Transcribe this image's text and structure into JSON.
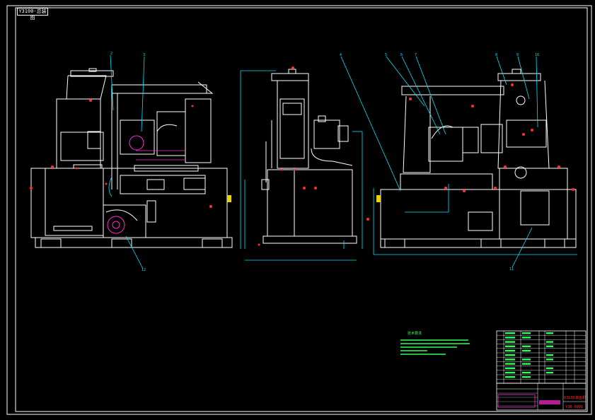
{
  "sheet": {
    "code_label": "Y3100-总装图",
    "background": "#000000",
    "line_color": "#ffffff",
    "dim_color": "#00e5ff",
    "accent_color": "#ff2bd1",
    "center_color": "#ff3030"
  },
  "callouts": [
    "2",
    "3",
    "4",
    "5",
    "6",
    "7",
    "8",
    "9",
    "10",
    "11",
    "12"
  ],
  "notes": {
    "title": "技术要求",
    "lines": [
      "",
      "",
      "",
      "",
      ""
    ]
  },
  "title_block": {
    "drawing_name": "Y3100滚齿机",
    "drawing_code": "Y3B-0001"
  },
  "icons": [
    "left-view-machine-icon",
    "front-view-machine-icon",
    "right-view-machine-icon",
    "parts-list-table-icon",
    "title-block-icon"
  ]
}
